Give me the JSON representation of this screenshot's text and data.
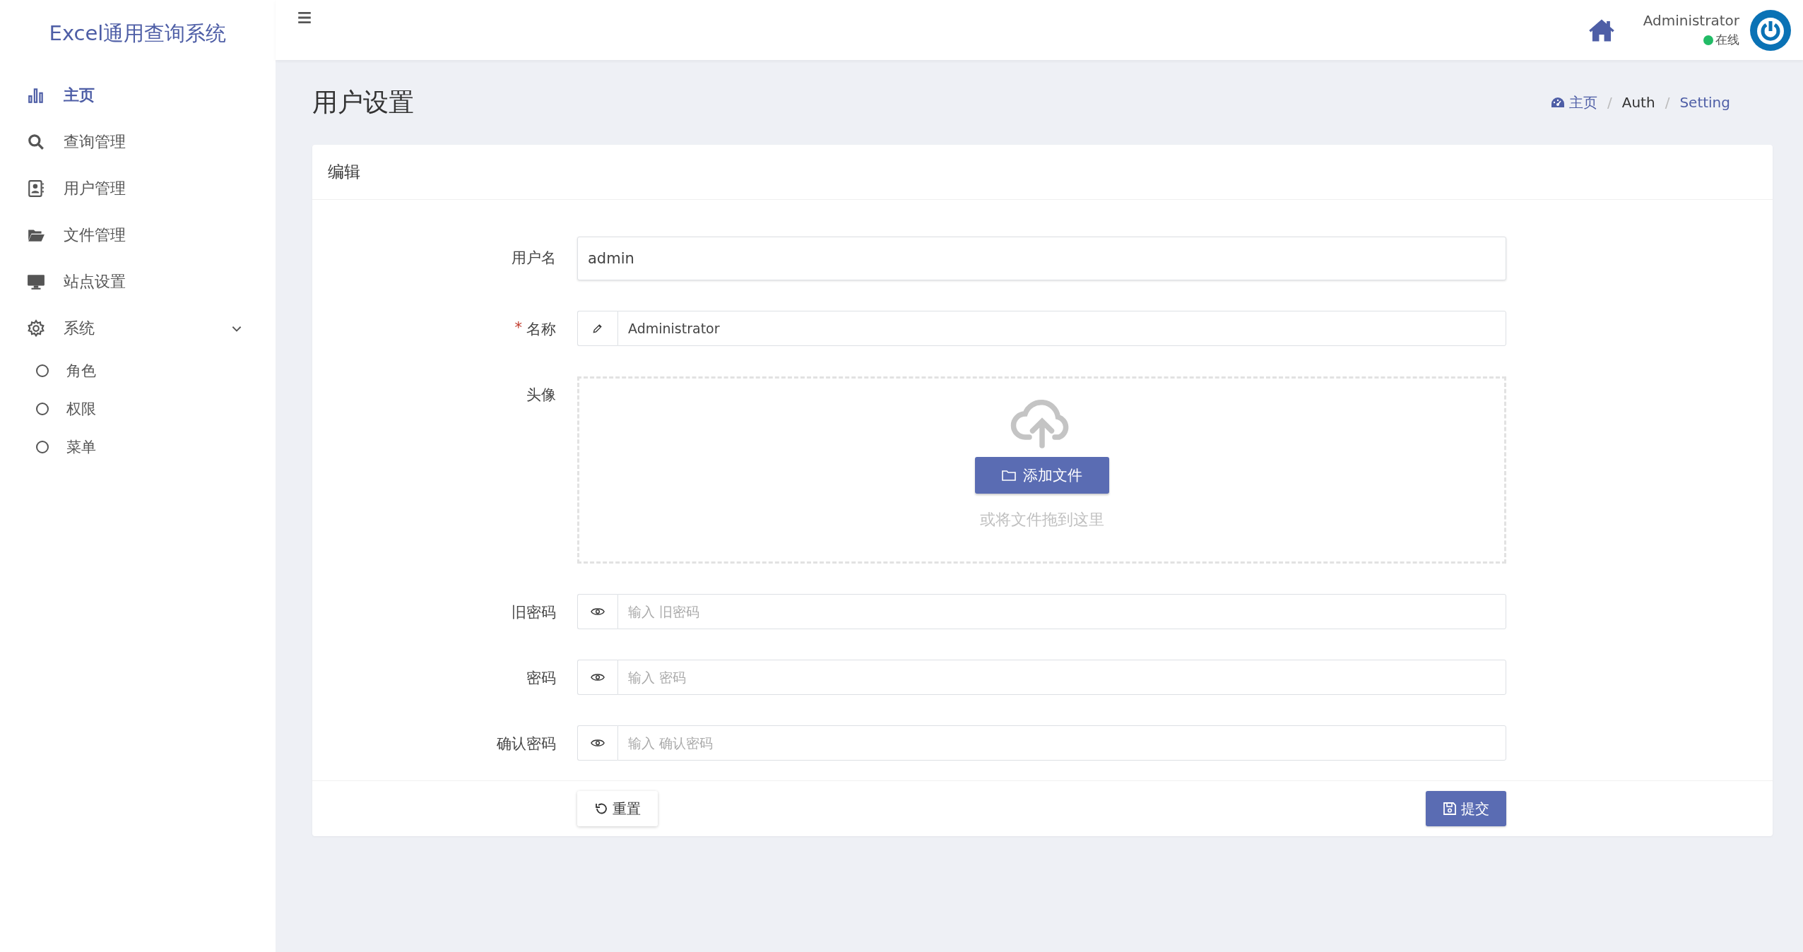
{
  "sidebar": {
    "logo": "Excel通用查询系统",
    "items": [
      {
        "label": "主页",
        "selected": true
      },
      {
        "label": "查询管理",
        "selected": false
      },
      {
        "label": "用户管理",
        "selected": false
      },
      {
        "label": "文件管理",
        "selected": false
      },
      {
        "label": "站点设置",
        "selected": false
      },
      {
        "label": "系统",
        "selected": false,
        "expanded": true,
        "children": [
          {
            "label": "角色",
            "selected": false
          },
          {
            "label": "权限",
            "selected": false
          },
          {
            "label": "菜单",
            "selected": false
          }
        ]
      }
    ]
  },
  "header": {
    "user": "Administrator",
    "status": "在线"
  },
  "page": {
    "title": "用户设置",
    "separator": "/",
    "breadcrumb": [
      {
        "label": "主页",
        "kind": "home"
      },
      {
        "label": "Auth",
        "kind": "plain"
      },
      {
        "label": "Setting",
        "kind": "current"
      }
    ]
  },
  "card": {
    "title": "编辑",
    "required_mark": "*",
    "fields": [
      {
        "kind": "text",
        "label": "用户名",
        "required": false,
        "value": "admin"
      },
      {
        "kind": "edit",
        "label": "名称",
        "required": true,
        "value": "Administrator"
      },
      {
        "kind": "upload",
        "label": "头像",
        "required": false,
        "button": "添加文件",
        "hint": "或将文件拖到这里"
      },
      {
        "kind": "password",
        "label": "旧密码",
        "required": false,
        "placeholder": "输入 旧密码"
      },
      {
        "kind": "password",
        "label": "密码",
        "required": false,
        "placeholder": "输入 密码"
      },
      {
        "kind": "password",
        "label": "确认密码",
        "required": false,
        "placeholder": "输入 确认密码"
      }
    ],
    "reset_button": "重置",
    "submit_button": "提交"
  }
}
